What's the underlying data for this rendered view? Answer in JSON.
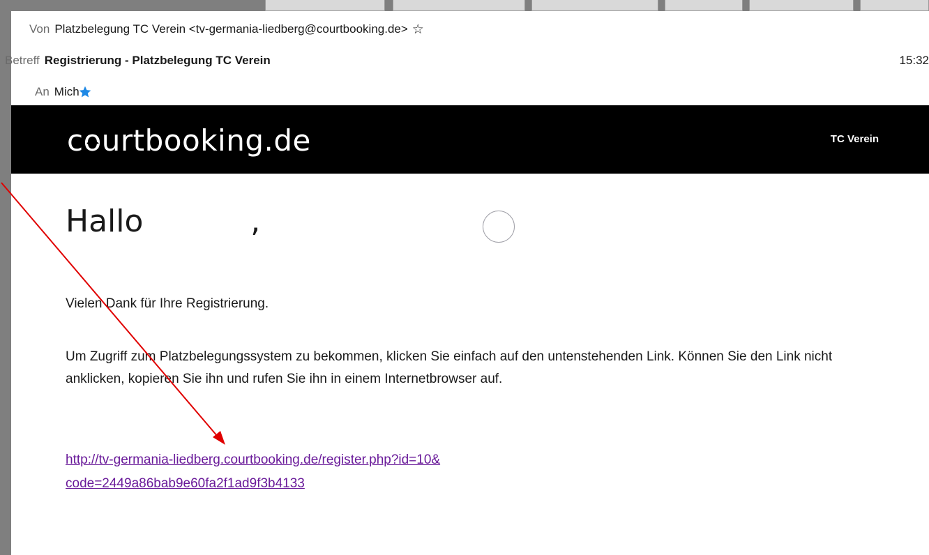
{
  "header": {
    "from_label": "Von",
    "from_value": "Platzbelegung TC Verein <tv-germania-liedberg@courtbooking.de>",
    "subject_label": "Betreff",
    "subject_value": "Registrierung - Platzbelegung TC Verein",
    "time": "15:32",
    "to_label": "An",
    "to_value": "Mich",
    "star_color": "#1e88e5"
  },
  "banner": {
    "logo_text_pre": "c",
    "logo_text_o": "o",
    "logo_text_post": "urtbooking.de",
    "club_name": "TC Verein",
    "background": "#000000"
  },
  "body": {
    "greeting": "Hallo           ,",
    "para1": "Vielen Dank für Ihre Registrierung.",
    "para2": "Um Zugriff zum Platzbelegungssystem zu bekommen, klicken Sie einfach auf den untenstehenden Link. Können Sie den Link nicht anklicken, kopieren Sie ihn und rufen Sie ihn in einem Internetbrowser auf.",
    "link_line1": "http://tv-germania-liedberg.courtbooking.de/register.php?id=10&",
    "link_line2": "code=2449a86bab9e60fa2f1ad9f3b4133",
    "link_color": "#6a1b9a"
  },
  "annotation": {
    "arrow_color": "#e00000"
  }
}
